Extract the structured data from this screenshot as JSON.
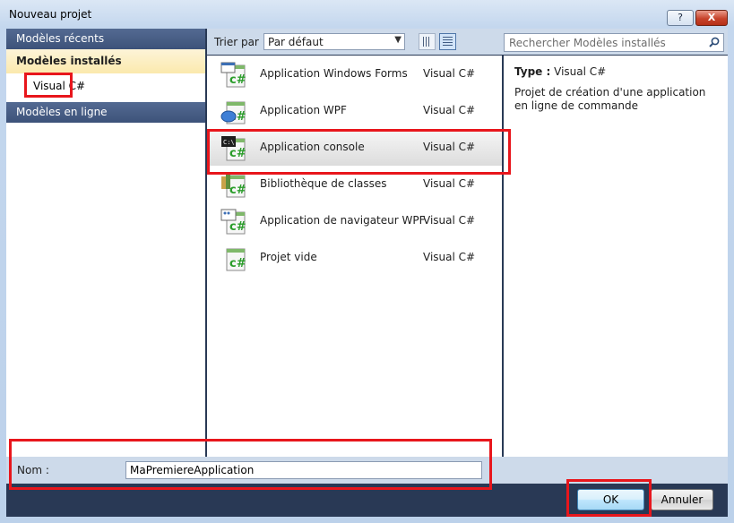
{
  "window": {
    "title": "Nouveau projet",
    "help_label": "?",
    "close_label": "X"
  },
  "nav": {
    "recent": "Modèles récents",
    "installed": "Modèles installés",
    "visual_csharp": "Visual C#",
    "online": "Modèles en ligne"
  },
  "toolbar": {
    "sort_label": "Trier par :",
    "sort_value": "Par défaut",
    "search_placeholder": "Rechercher Modèles installés"
  },
  "templates": [
    {
      "name": "Application Windows Forms",
      "lang": "Visual C#",
      "icon": "windows-forms-csharp-icon"
    },
    {
      "name": "Application WPF",
      "lang": "Visual C#",
      "icon": "wpf-csharp-icon"
    },
    {
      "name": "Application console",
      "lang": "Visual C#",
      "icon": "console-csharp-icon",
      "selected": true
    },
    {
      "name": "Bibliothèque de classes",
      "lang": "Visual C#",
      "icon": "class-library-csharp-icon"
    },
    {
      "name": "Application de navigateur WPF",
      "lang": "Visual C#",
      "icon": "wpf-browser-csharp-icon"
    },
    {
      "name": "Projet vide",
      "lang": "Visual C#",
      "icon": "empty-project-csharp-icon"
    }
  ],
  "details": {
    "type_label": "Type :",
    "type_value": "Visual C#",
    "description": "Projet de création d'une application en ligne de commande"
  },
  "bottom": {
    "name_label": "Nom :",
    "name_value": "MaPremiereApplication",
    "ok_label": "OK",
    "cancel_label": "Annuler"
  },
  "colors": {
    "highlight": "#e8161c",
    "csharp_green": "#2a9d2a"
  }
}
